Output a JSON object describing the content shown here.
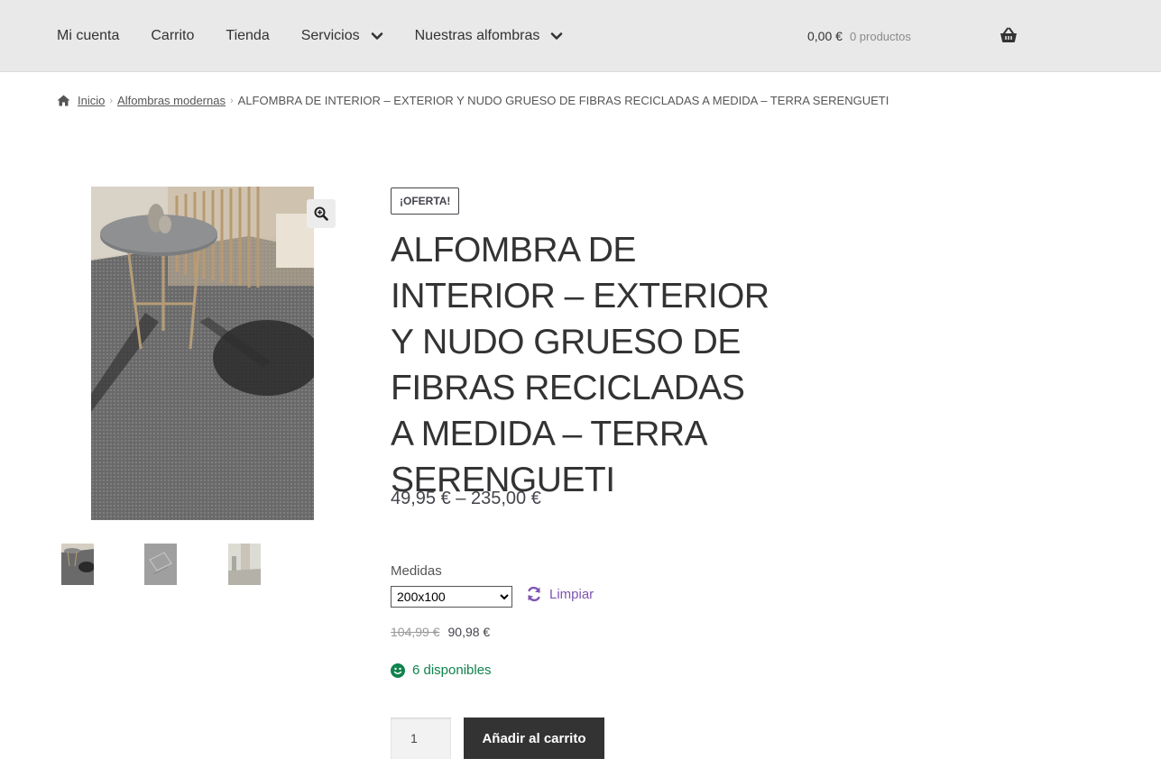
{
  "header": {
    "nav": [
      {
        "label": "Mi cuenta"
      },
      {
        "label": "Carrito"
      },
      {
        "label": "Tienda"
      },
      {
        "label": "Servicios",
        "has_dropdown": true
      },
      {
        "label": "Nuestras alfombras",
        "has_dropdown": true
      }
    ],
    "cart_amount": "0,00 €",
    "cart_count": "0 productos",
    "cart_icon": "basket-icon"
  },
  "breadcrumb": {
    "home_icon": "home-icon",
    "home": "Inicio",
    "category": "Alfombras modernas",
    "current": "ALFOMBRA DE INTERIOR – EXTERIOR Y NUDO GRUESO DE FIBRAS RECICLADAS A MEDIDA – TERRA SERENGUETI"
  },
  "gallery": {
    "zoom_icon": "magnifier-plus-icon",
    "thumbnail_count": 3
  },
  "product": {
    "badge": "¡OFERTA!",
    "title": "ALFOMBRA DE INTERIOR – EXTERIOR Y NUDO GRUESO DE FIBRAS RECICLADAS A MEDIDA – TERRA SERENGUETI",
    "price_range": "49,95 € – 235,00 €",
    "variation_label": "Medidas",
    "variation_selected": "200x100",
    "reset_label": "Limpiar",
    "regular_price": "104,99 €",
    "sale_price": "90,98 €",
    "stock": "6 disponibles",
    "quantity": "1",
    "add_to_cart": "Añadir al carrito"
  },
  "colors": {
    "header_bg": "#e9e9e9",
    "button_bg": "#333333",
    "link_purple": "#7f54b3",
    "stock_green": "#0f834d"
  }
}
